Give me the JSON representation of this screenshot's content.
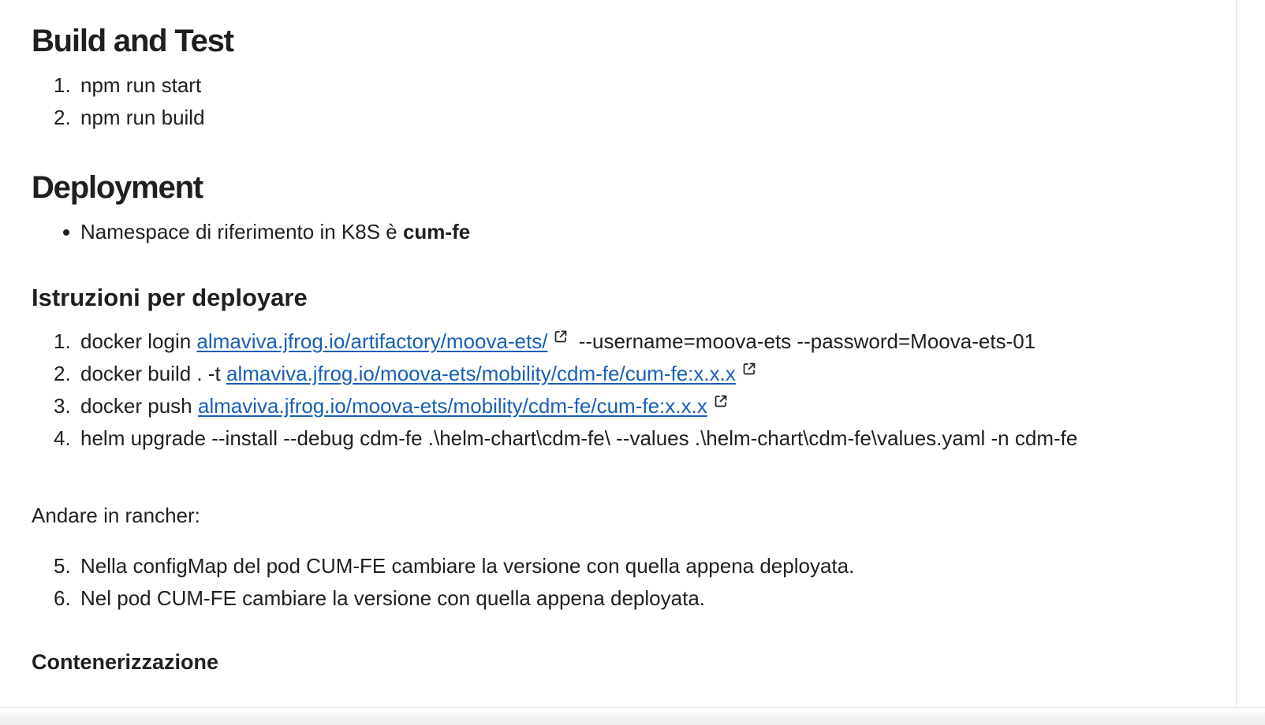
{
  "sections": {
    "build_test": {
      "heading": "Build and Test",
      "items": [
        "npm run start",
        "npm run build"
      ]
    },
    "deployment": {
      "heading": "Deployment",
      "bullet_text": "Namespace di riferimento in K8S è ",
      "bullet_bold": "cum-fe"
    },
    "istruzioni": {
      "heading": "Istruzioni per deployare",
      "items": [
        {
          "num": "1.",
          "prefix": "docker login ",
          "link": "almaviva.jfrog.io/artifactory/moova-ets/",
          "suffix": " --username=moova-ets --password=Moova-ets-01"
        },
        {
          "num": "2.",
          "prefix": "docker build . -t ",
          "link": "almaviva.jfrog.io/moova-ets/mobility/cdm-fe/cum-fe:x.x.x",
          "suffix": ""
        },
        {
          "num": "3.",
          "prefix": "docker push ",
          "link": "almaviva.jfrog.io/moova-ets/mobility/cdm-fe/cum-fe:x.x.x",
          "suffix": ""
        },
        {
          "num": "4.",
          "text": "helm upgrade --install --debug cdm-fe .\\helm-chart\\cdm-fe\\ --values .\\helm-chart\\cdm-fe\\values.yaml -n cdm-fe"
        }
      ]
    },
    "rancher": {
      "intro": "Andare in rancher:",
      "items": [
        {
          "num": "5.",
          "text": "Nella configMap del pod CUM-FE cambiare la versione con quella appena deployata."
        },
        {
          "num": "6.",
          "text": "Nel pod CUM-FE cambiare la versione con quella appena deployata."
        }
      ]
    },
    "containerization": {
      "heading": "Contenerizzazione"
    }
  },
  "icons": {
    "external_link": "external-link-icon"
  },
  "colors": {
    "text": "#1f1f1f",
    "link": "#1a5fb4"
  }
}
